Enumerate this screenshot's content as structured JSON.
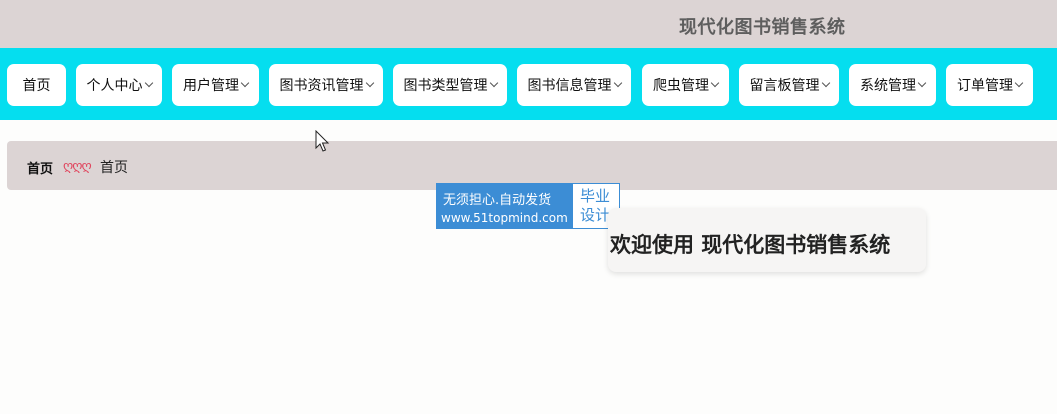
{
  "header": {
    "title": "现代化图书销售系统"
  },
  "nav": {
    "items": [
      {
        "label": "首页",
        "has_dropdown": false
      },
      {
        "label": "个人中心",
        "has_dropdown": true
      },
      {
        "label": "用户管理",
        "has_dropdown": true
      },
      {
        "label": "图书资讯管理",
        "has_dropdown": true
      },
      {
        "label": "图书类型管理",
        "has_dropdown": true
      },
      {
        "label": "图书信息管理",
        "has_dropdown": true
      },
      {
        "label": "爬虫管理",
        "has_dropdown": true
      },
      {
        "label": "留言板管理",
        "has_dropdown": true
      },
      {
        "label": "系统管理",
        "has_dropdown": true
      },
      {
        "label": "订单管理",
        "has_dropdown": true
      }
    ]
  },
  "breadcrumb": {
    "home": "首页",
    "separator": "ღღღ",
    "current": "首页"
  },
  "watermark": {
    "line1": "无须担心.自动发货",
    "line2": "www.51topmind.com",
    "right_line1": "毕业",
    "right_line2": "设计"
  },
  "main": {
    "welcome": "欢迎使用 现代化图书销售系统"
  },
  "colors": {
    "header_bg": "#dcd4d4",
    "nav_bg": "#05deef",
    "separator": "#e0455d",
    "watermark": "#3c8dd5"
  }
}
